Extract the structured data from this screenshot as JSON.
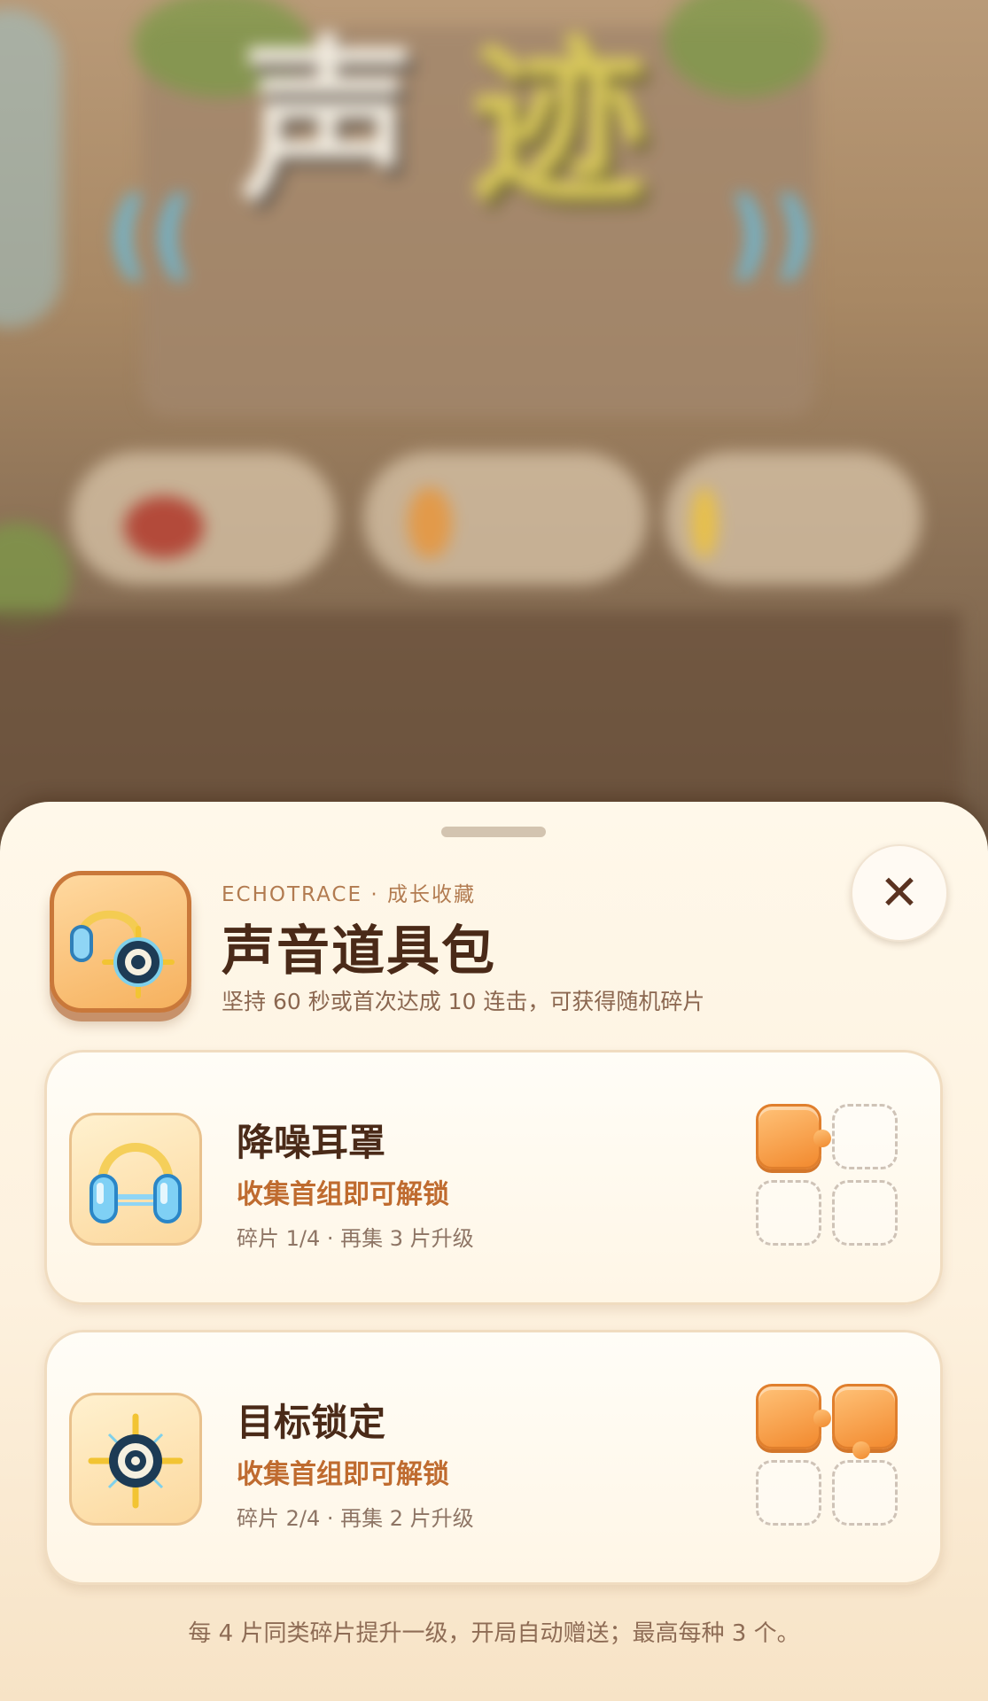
{
  "background": {
    "title_chars": [
      "声",
      "迹"
    ]
  },
  "sheet": {
    "brand": "ECHOTRACE · 成长收藏",
    "title": "声音道具包",
    "subtitle": "坚持 60 秒或首次达成 10 连击，可获得随机碎片",
    "close_label": "✕",
    "items": [
      {
        "name": "降噪耳罩",
        "status": "收集首组即可解锁",
        "progress": "碎片 1/4 · 再集 3 片升级",
        "fragments_collected": 1,
        "fragments_total": 4,
        "icon": "earmuffs-icon"
      },
      {
        "name": "目标锁定",
        "status": "收集首组即可解锁",
        "progress": "碎片 2/4 · 再集 2 片升级",
        "fragments_collected": 2,
        "fragments_total": 4,
        "icon": "target-lock-icon"
      }
    ],
    "footer_note": "每 4 片同类碎片提升一级，开局自动赠送；最高每种 3 个。"
  },
  "colors": {
    "accent": "#bf6b2f",
    "title": "#4a2a18",
    "fragment": "#f28a2f"
  }
}
